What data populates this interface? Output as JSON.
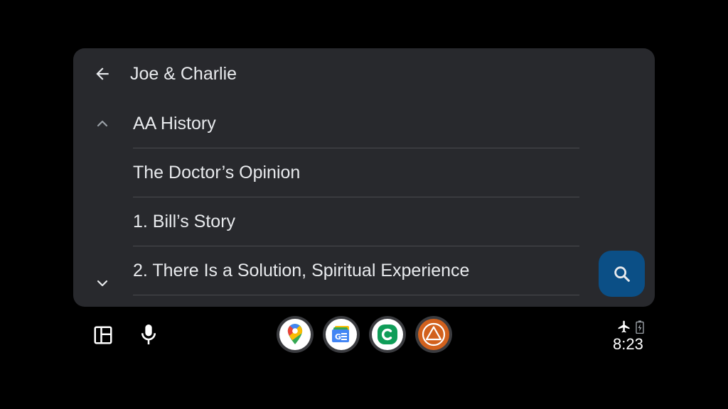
{
  "header": {
    "title": "Joe & Charlie"
  },
  "list": {
    "items": [
      {
        "label": "AA History"
      },
      {
        "label": "The Doctor’s Opinion"
      },
      {
        "label": "1. Bill’s Story"
      },
      {
        "label": "2. There Is a Solution, Spiritual Experience"
      }
    ]
  },
  "icons": {
    "back": "arrow-back-icon",
    "scroll_up": "chevron-up-icon",
    "scroll_down": "chevron-down-icon",
    "search": "search-icon",
    "layout": "dashboard-layout-icon",
    "mic": "microphone-icon",
    "airplane": "airplane-mode-icon",
    "battery": "battery-charging-icon"
  },
  "dock": {
    "apps": [
      {
        "name": "google-maps-app"
      },
      {
        "name": "google-news-app"
      },
      {
        "name": "green-c-app"
      },
      {
        "name": "aa-triangle-app"
      }
    ]
  },
  "status_bar": {
    "time": "8:23"
  },
  "colors": {
    "background": "#000000",
    "card": "#28292d",
    "divider": "#4a4b4f",
    "fab": "#0b4f86",
    "text": "#e8eaed"
  }
}
